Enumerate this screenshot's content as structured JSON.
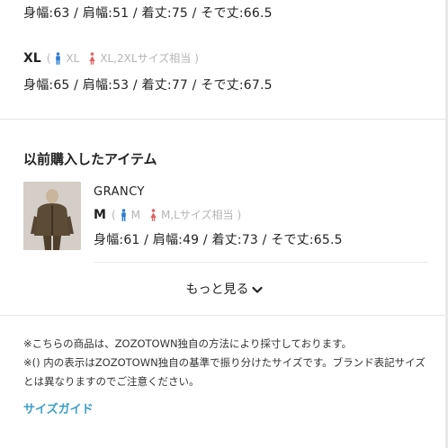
{
  "top_size": {
    "measurements": "身幅:63 / 肩幅:51 / 着丈:75 / そで丈:66.5"
  },
  "size_xl": {
    "name": "XL",
    "open_paren": "(",
    "male": "XL",
    "female": "XL,2XLサイズ相当",
    "close_paren": ")",
    "measurements": "身幅:65 / 肩幅:53 / 着丈:77 / そで丈:67.5"
  },
  "history": {
    "title": "以前購入したアイテム",
    "item": {
      "brand": "GRANCY",
      "size": "M",
      "open_paren": "(",
      "male": "M",
      "female": "M,Lサイズ相当",
      "close_paren": ")",
      "measurements": "身幅:61 / 肩幅:49 / 着丈:73 / そで丈:65.5"
    },
    "more_label": "もっと見る"
  },
  "notes": {
    "line1": "※こちらの商品は、ZOZOTOWN独自の方法により採寸しております。",
    "line2": "※() 内の表示はZOZOTOWN独自の基準で振り分けたサイズです。ブランド表記サイズとは異なりますのでご注意ください。"
  },
  "size_guide_link": "サイズガイド",
  "colors": {
    "male_icon": "#2b7bd3",
    "female_icon": "#e0605f",
    "link": "#3ba0c8",
    "muted": "#b5b5b5"
  },
  "icons": {
    "male": "male-figure-icon",
    "female": "female-figure-icon",
    "chevron": "chevron-down-icon"
  }
}
